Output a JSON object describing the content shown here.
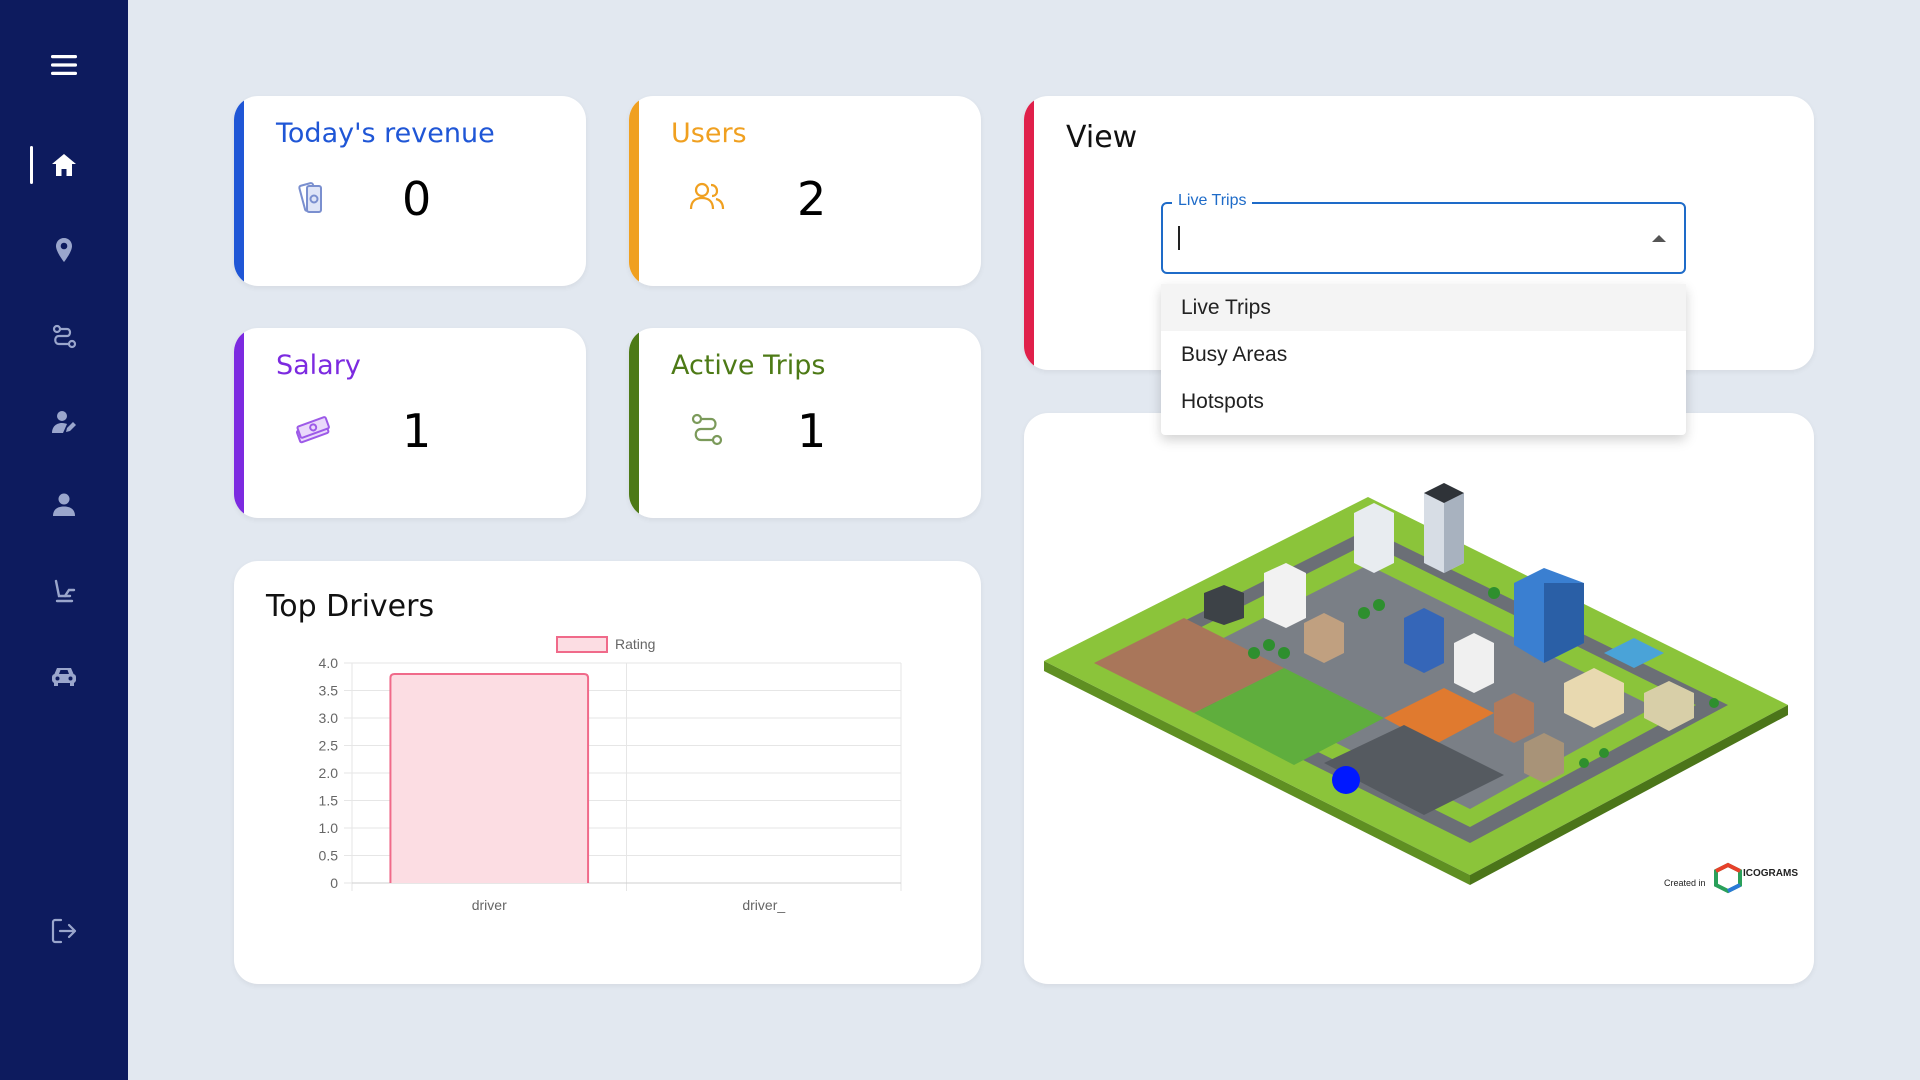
{
  "sidebar": {
    "items": [
      {
        "name": "menu-icon"
      },
      {
        "name": "home-icon"
      },
      {
        "name": "location-pin-icon"
      },
      {
        "name": "route-icon"
      },
      {
        "name": "user-edit-icon"
      },
      {
        "name": "user-icon"
      },
      {
        "name": "seat-icon"
      },
      {
        "name": "taxi-icon"
      },
      {
        "name": "logout-icon"
      }
    ]
  },
  "stats": {
    "revenue": {
      "title": "Today's revenue",
      "value": "0",
      "color": "#1f56d6",
      "icon": "money-icon"
    },
    "users": {
      "title": "Users",
      "value": "2",
      "color": "#f0a020",
      "icon": "users-icon"
    },
    "salary": {
      "title": "Salary",
      "value": "1",
      "color": "#7c2ae0",
      "icon": "cash-stack-icon"
    },
    "active_trips": {
      "title": "Active Trips",
      "value": "1",
      "color": "#4d7a16",
      "icon": "route-icon"
    }
  },
  "view": {
    "title": "View",
    "accent": "#e0204a",
    "select_label": "Live Trips",
    "select_value": "",
    "options": [
      "Live Trips",
      "Busy Areas",
      "Hotspots"
    ],
    "selected_option": "Live Trips"
  },
  "map": {
    "credit_prefix": "Created in",
    "credit_brand": "ICOGRAMS"
  },
  "top_drivers": {
    "title": "Top Drivers"
  },
  "chart_data": {
    "type": "bar",
    "categories": [
      "driver",
      "driver_"
    ],
    "series": [
      {
        "name": "Rating",
        "values": [
          3.8,
          0
        ]
      }
    ],
    "ylim": [
      0,
      4.0
    ],
    "yticks": [
      "4.0",
      "3.5",
      "3.0",
      "2.5",
      "2.0",
      "1.5",
      "1.0",
      "0.5",
      "0"
    ],
    "legend_position": "top-center",
    "grid": true,
    "bar_fill": "#fcdde3",
    "bar_stroke": "#f06a8a"
  }
}
